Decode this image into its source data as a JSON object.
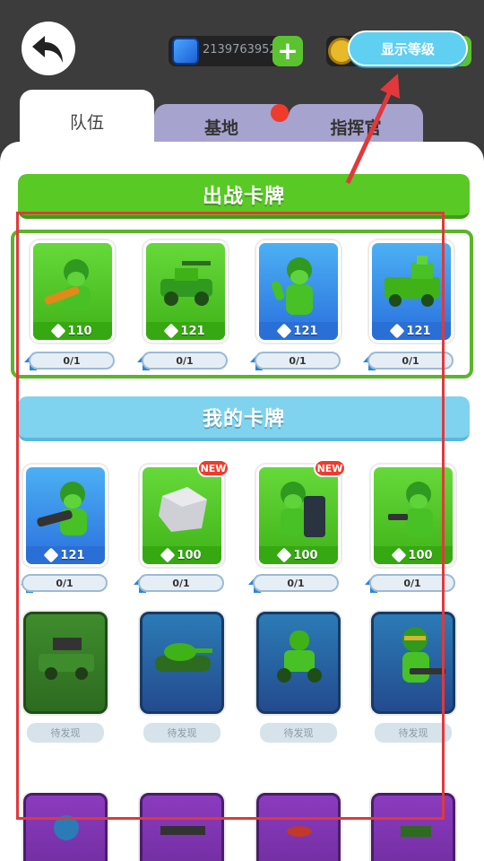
{
  "topbar": {
    "gem_value": "2139763952",
    "level_button": "显示等级"
  },
  "tabs": [
    "队伍",
    "基地",
    "指挥官"
  ],
  "sections": {
    "battle": "出战卡牌",
    "mine": "我的卡牌"
  },
  "battle_cards": [
    {
      "power": "110",
      "progress": "0/1",
      "color": "green",
      "art": "soldier-bazooka"
    },
    {
      "power": "121",
      "progress": "0/1",
      "color": "green",
      "art": "jeep"
    },
    {
      "power": "121",
      "progress": "0/1",
      "color": "blue",
      "art": "soldier-wave"
    },
    {
      "power": "121",
      "progress": "0/1",
      "color": "blue",
      "art": "armored-truck"
    }
  ],
  "my_cards": [
    {
      "power": "121",
      "progress": "0/1",
      "color": "blue",
      "new": false,
      "art": "soldier-bazooka"
    },
    {
      "power": "100",
      "progress": "0/1",
      "color": "green",
      "new": true,
      "new_label": "NEW",
      "art": "stone-block"
    },
    {
      "power": "100",
      "progress": "0/1",
      "color": "green",
      "new": true,
      "new_label": "NEW",
      "art": "soldier-shield"
    },
    {
      "power": "100",
      "progress": "0/1",
      "color": "green",
      "new": false,
      "art": "soldier-pistol"
    }
  ],
  "locked_cards": [
    {
      "label": "待发现",
      "color": "green",
      "art": "missile-truck"
    },
    {
      "label": "待发现",
      "color": "blue",
      "art": "tank"
    },
    {
      "label": "待发现",
      "color": "blue",
      "art": "robot"
    },
    {
      "label": "待发现",
      "color": "blue",
      "art": "soldier-gunner"
    }
  ],
  "colors": {
    "accent_green": "#59c925",
    "accent_blue": "#7fd3ef",
    "highlight_red": "#e2383b"
  }
}
